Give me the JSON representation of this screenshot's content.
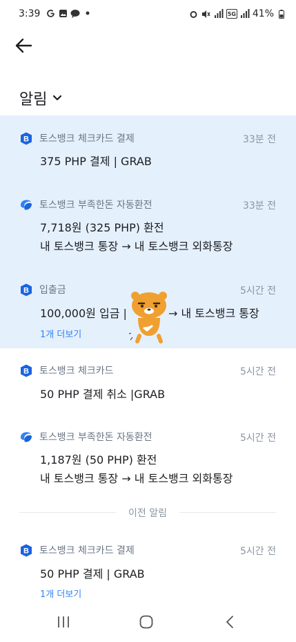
{
  "status_bar": {
    "time": "3:39",
    "left_icons": [
      "google-icon",
      "gallery-icon",
      "talk-icon",
      "dot-icon"
    ],
    "battery": "41%",
    "network": "5G"
  },
  "header": {
    "title": "알림"
  },
  "notifications": [
    {
      "source": "토스뱅크 체크카드 결제",
      "time": "33분 전",
      "lines": [
        "375 PHP 결제 | GRAB"
      ],
      "icon": "bank-b-icon"
    },
    {
      "source": "토스뱅크 부족한돈 자동환전",
      "time": "33분 전",
      "lines": [
        "7,718원 (325 PHP) 환전",
        "내 토스뱅크 통장 → 내 토스뱅크 외화통장"
      ],
      "icon": "exchange-icon"
    },
    {
      "source": "입출금",
      "time": "5시간 전",
      "lines": [
        "100,000원 입금 | ",
        "→ 내 토스뱅크 통장"
      ],
      "more": "1개 더보기",
      "icon": "bank-b-icon"
    },
    {
      "source": "토스뱅크 체크카드",
      "time": "5시간 전",
      "lines": [
        "50 PHP 결제 취소 |GRAB"
      ],
      "icon": "bank-b-icon"
    },
    {
      "source": "토스뱅크 부족한돈 자동환전",
      "time": "5시간 전",
      "lines": [
        "1,187원 (50 PHP) 환전",
        "내 토스뱅크 통장 → 내 토스뱅크 외화통장"
      ],
      "icon": "exchange-icon"
    },
    {
      "source": "토스뱅크 체크카드 결제",
      "time": "5시간 전",
      "lines": [
        "50 PHP 결제 | GRAB"
      ],
      "more": "1개 더보기",
      "icon": "bank-b-icon"
    }
  ],
  "divider": {
    "label": "이전 알림"
  },
  "colors": {
    "accent": "#3182f6",
    "highlight": "#e5f0fd",
    "bank_icon": "#1a63e0"
  }
}
